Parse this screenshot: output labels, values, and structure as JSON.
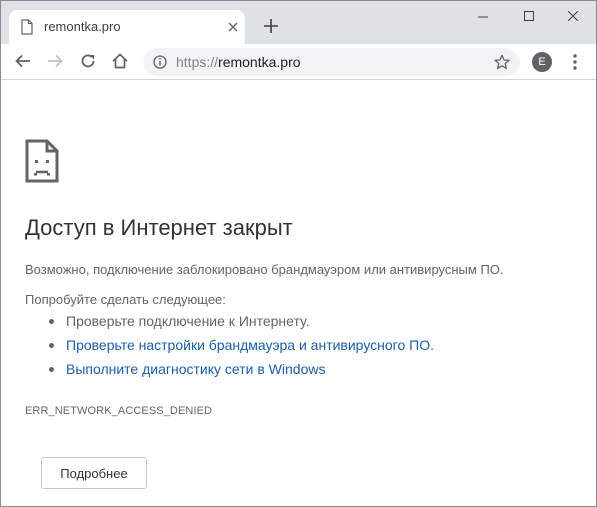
{
  "tab": {
    "title": "remontka.pro"
  },
  "omnibox": {
    "scheme": "https://",
    "host": "remontka.pro"
  },
  "profile": {
    "initial": "E"
  },
  "error": {
    "title": "Доступ в Интернет закрыт",
    "description": "Возможно, подключение заблокировано брандмауэром или антивирусным ПО.",
    "try_label": "Попробуйте сделать следующее:",
    "suggestions": [
      {
        "text": "Проверьте подключение к Интернету.",
        "is_link": false
      },
      {
        "text": "Проверьте настройки брандмауэра и антивирусного ПО.",
        "is_link": true
      },
      {
        "text": "Выполните диагностику сети в Windows",
        "is_link": true
      }
    ],
    "code": "ERR_NETWORK_ACCESS_DENIED",
    "details_button": "Подробнее"
  },
  "colors": {
    "tabstrip": "#dee1e6",
    "link": "#1a5ea8",
    "text": "#646464",
    "heading": "#333333"
  }
}
